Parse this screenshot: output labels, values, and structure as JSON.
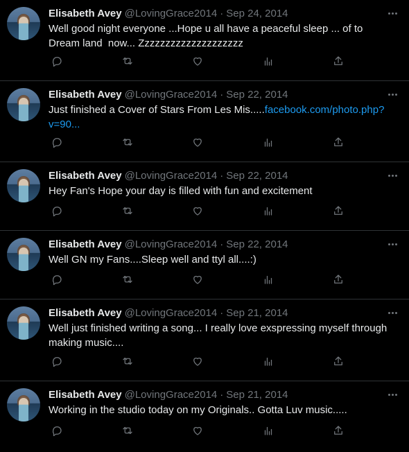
{
  "tweets": [
    {
      "name": "Elisabeth Avey",
      "handle": "@LovingGrace2014",
      "date": "Sep 24, 2014",
      "text": "Well good night everyone ...Hope u all have a peaceful sleep ... of to Dream land  now... Zzzzzzzzzzzzzzzzzzzz",
      "link": ""
    },
    {
      "name": "Elisabeth Avey",
      "handle": "@LovingGrace2014",
      "date": "Sep 22, 2014",
      "text": "Just finished a Cover of Stars From Les Mis.....",
      "link": "facebook.com/photo.php?v=90..."
    },
    {
      "name": "Elisabeth Avey",
      "handle": "@LovingGrace2014",
      "date": "Sep 22, 2014",
      "text": "Hey Fan's Hope your day is filled with fun and excitement",
      "link": ""
    },
    {
      "name": "Elisabeth Avey",
      "handle": "@LovingGrace2014",
      "date": "Sep 22, 2014",
      "text": "Well GN my Fans....Sleep well and ttyl all....:)",
      "link": ""
    },
    {
      "name": "Elisabeth Avey",
      "handle": "@LovingGrace2014",
      "date": "Sep 21, 2014",
      "text": "Well just finished writing a song... I really love exspressing myself through making music....",
      "link": ""
    },
    {
      "name": "Elisabeth Avey",
      "handle": "@LovingGrace2014",
      "date": "Sep 21, 2014",
      "text": "Working in the studio today on my Originals.. Gotta Luv music.....",
      "link": ""
    }
  ],
  "separator": "·",
  "colors": {
    "background": "#000000",
    "text": "#e7e9ea",
    "muted": "#71767b",
    "link": "#1d9bf0",
    "border": "#2f3336"
  },
  "icons": [
    "reply-icon",
    "retweet-icon",
    "like-icon",
    "views-icon",
    "share-icon",
    "more-icon"
  ]
}
